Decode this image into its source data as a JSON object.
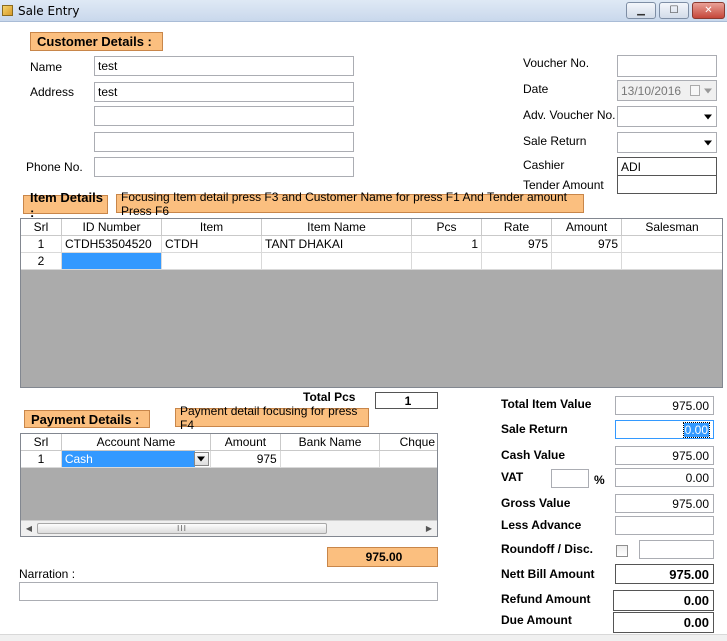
{
  "window": {
    "title": "Sale Entry",
    "minimize_glyph": "▁",
    "maximize_glyph": "☐",
    "close_glyph": "✕"
  },
  "customer": {
    "section_label": "Customer Details :",
    "name_label": "Name",
    "name_value": "test",
    "address_label": "Address",
    "address_line1": "test",
    "address_line2": "",
    "address_line3": "",
    "phone_label": "Phone No.",
    "phone_value": ""
  },
  "voucher": {
    "voucher_no_label": "Voucher No.",
    "voucher_no_value": "",
    "date_label": "Date",
    "date_value": "13/10/2016",
    "adv_voucher_label": "Adv. Voucher No.",
    "adv_voucher_value": "",
    "sale_return_label": "Sale Return",
    "sale_return_value": "",
    "cashier_label": "Cashier",
    "cashier_value": "ADI",
    "tender_label": "Tender Amount",
    "tender_value": ""
  },
  "items": {
    "section_label": "Item Details :",
    "hint": "Focusing Item detail  press F3 and Customer Name for press F1 And Tender amount Press F6",
    "columns": [
      "Srl",
      "ID Number",
      "Item",
      "Item Name",
      "Pcs",
      "Rate",
      "Amount",
      "Salesman"
    ],
    "rows": [
      {
        "srl": "1",
        "id": "CTDH53504520",
        "item": "CTDH",
        "name": "TANT DHAKAI",
        "pcs": "1",
        "rate": "975",
        "amount": "975",
        "salesman": ""
      },
      {
        "srl": "2",
        "id": "",
        "item": "",
        "name": "",
        "pcs": "",
        "rate": "",
        "amount": "",
        "salesman": ""
      }
    ],
    "total_pcs_label": "Total Pcs",
    "total_pcs_value": "1"
  },
  "payment": {
    "section_label": "Payment Details :",
    "hint": "Payment detail focusing for press F4",
    "columns": [
      "Srl",
      "Account Name",
      "Amount",
      "Bank Name",
      "Chque"
    ],
    "rows": [
      {
        "srl": "1",
        "account": "Cash",
        "amount": "975",
        "bank": "",
        "cheque": ""
      }
    ],
    "scroll_thumb": "III",
    "total_value": "975.00",
    "narration_label": "Narration :",
    "narration_value": ""
  },
  "totals": {
    "total_item_value_label": "Total Item Value",
    "total_item_value": "975.00",
    "sale_return_label": "Sale Return",
    "sale_return_value": "0.00",
    "cash_value_label": "Cash Value",
    "cash_value": "975.00",
    "vat_label": "VAT",
    "vat_percent": "",
    "vat_percent_sign": "%",
    "vat_value": "0.00",
    "gross_value_label": "Gross Value",
    "gross_value": "975.00",
    "less_advance_label": "Less Advance",
    "less_advance_value": "",
    "roundoff_label": "Roundoff / Disc.",
    "roundoff_value": "",
    "nett_bill_label": "Nett Bill Amount",
    "nett_bill_value": "975.00",
    "refund_label": "Refund Amount",
    "refund_value": "0.00",
    "due_label": "Due Amount",
    "due_value": "0.00"
  }
}
